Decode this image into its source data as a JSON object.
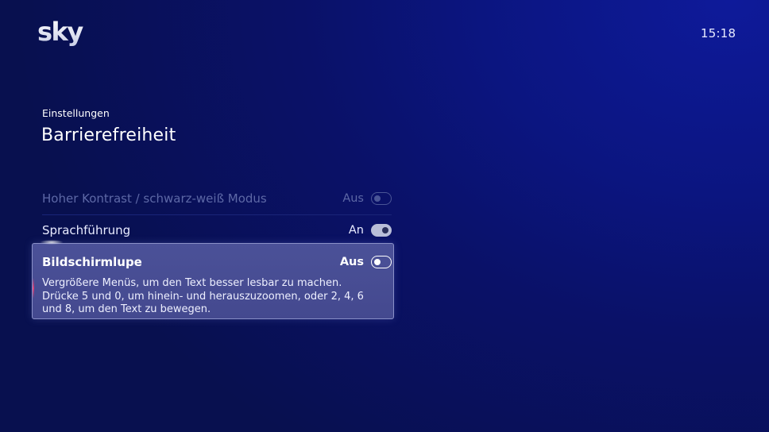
{
  "header": {
    "logo_text": "sky",
    "clock": "15:18"
  },
  "breadcrumb": "Einstellungen",
  "page_title": "Barrierefreiheit",
  "settings": [
    {
      "label": "Hoher Kontrast / schwarz-weiß Modus",
      "state": "Aus",
      "enabled": false,
      "disabled_appearance": true
    },
    {
      "label": "Sprachführung",
      "state": "An",
      "enabled": true
    },
    {
      "label": "Bildschirmlupe",
      "state": "Aus",
      "enabled": false,
      "focused": true,
      "description": [
        "Vergrößere Menüs, um den Text besser lesbar zu machen.",
        "Drücke 5 und 0, um hinein- und herauszuzoomen, oder 2, 4, 6",
        "und 8, um den Text zu bewegen."
      ]
    }
  ],
  "colors": {
    "background": "#0a1168",
    "focus_card": "#4b5198",
    "focus_border": "#8a90c8",
    "disabled_text": "#5d68a6",
    "accent": "#d9447a"
  },
  "icons": {
    "logo": "sky-logo",
    "toggle": "toggle-switch"
  }
}
